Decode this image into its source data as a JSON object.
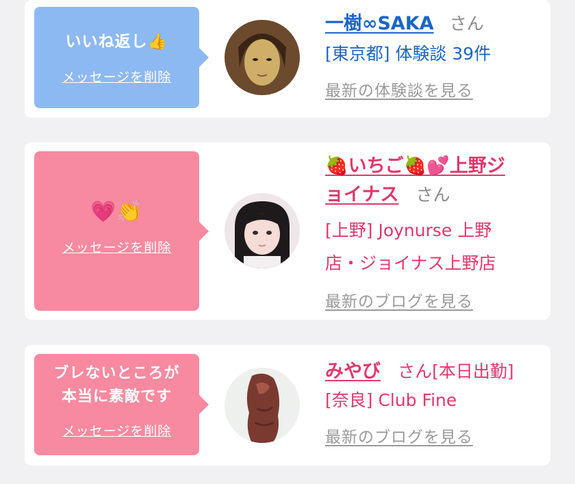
{
  "cards": [
    {
      "message": "いいね返し👍",
      "delete_label": "メッセージを削除",
      "name": "一樹∞SAKA",
      "san": "さん",
      "detail": "[東京都] 体験談 39件",
      "latest": "最新の体験談を見る"
    },
    {
      "message": "💗👏",
      "delete_label": "メッセージを削除",
      "name_line1": "🍓いちご🍓💕上野ジ",
      "name_line2": "ョイナス",
      "san": "さん",
      "detail_line1": "[上野] Joynurse 上野",
      "detail_line2": "店・ジョイナス上野店",
      "latest": "最新のブログを見る"
    },
    {
      "message_line1": "ブレないところが",
      "message_line2": "本当に素敵です",
      "delete_label": "メッセージを削除",
      "name": "みやび",
      "san_extra": "さん[本日出勤]",
      "detail": "[奈良] Club Fine",
      "latest": "最新のブログを見る"
    }
  ],
  "colors": {
    "blue_bubble": "#8db9f2",
    "pink_bubble": "#f78aa0",
    "blue_text": "#1c66c4",
    "pink_text": "#e0386a"
  }
}
